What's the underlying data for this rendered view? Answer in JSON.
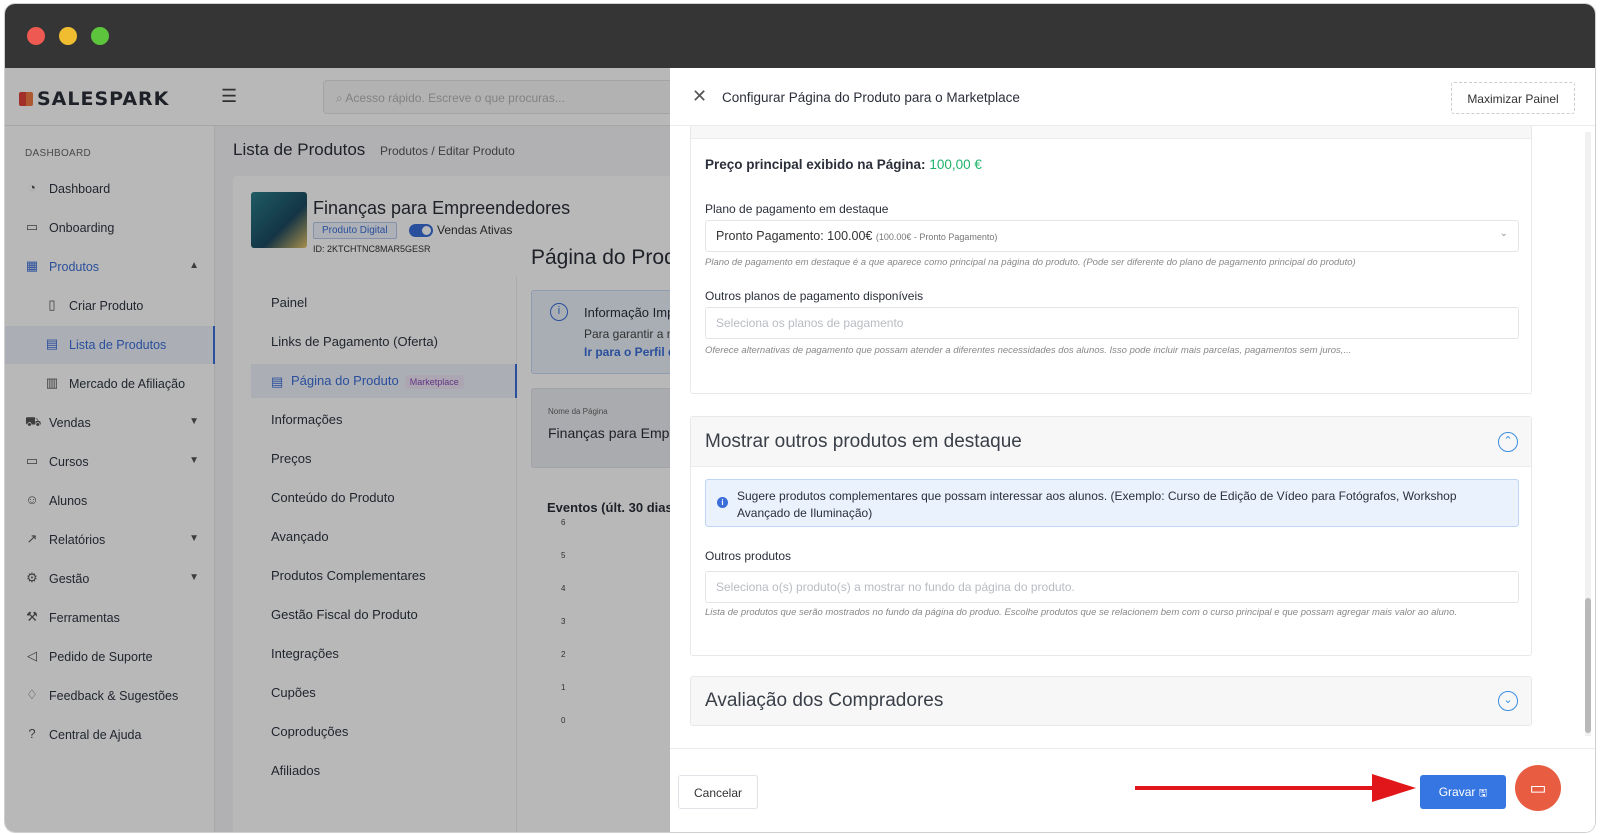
{
  "app": {
    "logo": "SALESPARK",
    "search_placeholder": "Acesso rápido. Escreve o que procuras..."
  },
  "sidebar": {
    "section": "DASHBOARD",
    "items": [
      {
        "label": "Dashboard",
        "icon": "gauge-icon"
      },
      {
        "label": "Onboarding",
        "icon": "onboarding-icon"
      },
      {
        "label": "Produtos",
        "icon": "grid-icon"
      },
      {
        "label": "Criar Produto",
        "icon": "file-plus-icon"
      },
      {
        "label": "Lista de Produtos",
        "icon": "table-icon"
      },
      {
        "label": "Mercado de Afiliação",
        "icon": "store-icon"
      },
      {
        "label": "Vendas",
        "icon": "cart-icon"
      },
      {
        "label": "Cursos",
        "icon": "monitor-icon"
      },
      {
        "label": "Alunos",
        "icon": "users-icon"
      },
      {
        "label": "Relatórios",
        "icon": "chart-icon"
      },
      {
        "label": "Gestão",
        "icon": "gear-icon"
      },
      {
        "label": "Ferramentas",
        "icon": "wrench-icon"
      },
      {
        "label": "Pedido de Suporte",
        "icon": "megaphone-icon"
      },
      {
        "label": "Feedback & Sugestões",
        "icon": "rocket-icon"
      },
      {
        "label": "Central de Ajuda",
        "icon": "help-icon"
      }
    ]
  },
  "main": {
    "page_title": "Lista de Produtos",
    "breadcrumb": "Produtos  /  Editar Produto",
    "product_title": "Finanças para Empreendedores",
    "product_type": "Produto Digital",
    "sales_status": "Vendas Ativas",
    "product_id": "ID: 2KTCHTNC8MAR5GESR",
    "menu": [
      "Painel",
      "Links de Pagamento (Oferta)",
      "Página do Produto",
      "Informações",
      "Preços",
      "Conteúdo do Produto",
      "Avançado",
      "Produtos Complementares",
      "Gestão Fiscal do Produto",
      "Integrações",
      "Cupões",
      "Coproduções",
      "Afiliados"
    ],
    "menu_badge": "Marketplace",
    "right_title": "Página do Prod",
    "info_title": "Informação Imp",
    "info_text": "Para garantir a me",
    "info_link": "Ir para o Perfil de",
    "name_label": "Nome da Página",
    "name_value": "Finanças para Empre",
    "events_title": "Eventos (últ. 30 dias)",
    "events_ticks": [
      "6",
      "5",
      "4",
      "3",
      "2",
      "1",
      "0"
    ]
  },
  "panel": {
    "title": "Configurar Página do Produto para o Marketplace",
    "maximize": "Maximizar Painel",
    "price_label": "Preço principal exibido na Página:",
    "price_value": "100,00 €",
    "plan_label": "Plano de pagamento em destaque",
    "plan_value": "Pronto Pagamento: 100.00€",
    "plan_value_sub": "(100.00€ - Pronto Pagamento)",
    "plan_hint": "Plano de pagamento em destaque é a que aparece como principal na página do produto. (Pode ser diferente do plano de pagamento principal do produto)",
    "other_plans_label": "Outros planos de pagamento disponíveis",
    "other_plans_placeholder": "Seleciona os planos de pagamento",
    "other_plans_hint": "Oferece alternativas de pagamento que possam atender a diferentes necessidades dos alunos. Isso pode incluir mais parcelas, pagamentos sem juros,...",
    "featured_title": "Mostrar outros produtos em destaque",
    "featured_alert": "Sugere produtos complementares que possam interessar aos alunos. (Exemplo: Curso de Edição de Vídeo para Fotógrafos, Workshop Avançado de Iluminação)",
    "other_products_label": "Outros produtos",
    "other_products_placeholder": "Seleciona o(s) produto(s) a mostrar no fundo da página do produto.",
    "other_products_hint": "Lista de produtos que serão mostrados no fundo da página do produo. Escolhe produtos que se relacionem bem com o curso principal e que possam agregar mais valor ao aluno.",
    "reviews_title": "Avaliação dos Compradores",
    "cancel": "Cancelar",
    "save": "Gravar"
  },
  "colors": {
    "accent": "#3576e3",
    "price": "#1fb36b",
    "arrow": "#e0161a",
    "chat": "#e85d42"
  }
}
